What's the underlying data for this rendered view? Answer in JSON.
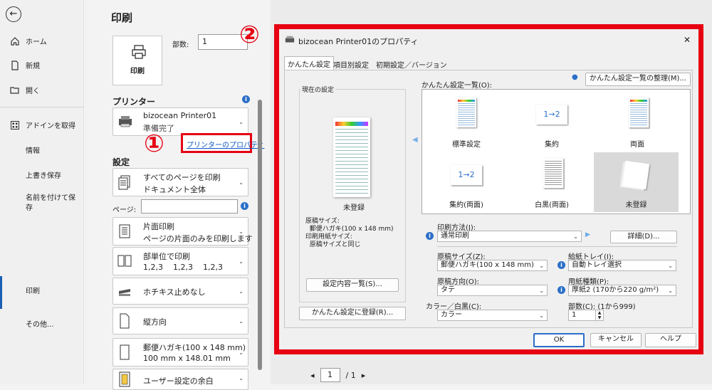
{
  "nav": {
    "items": [
      {
        "label": "ホーム",
        "icon": "home-icon"
      },
      {
        "label": "新規",
        "icon": "new-doc-icon"
      },
      {
        "label": "開く",
        "icon": "folder-icon"
      },
      {
        "label": "アドインを取得",
        "icon": "grid-icon"
      },
      {
        "label": "情報"
      },
      {
        "label": "上書き保存"
      },
      {
        "label": "名前を付けて保\n存"
      },
      {
        "label": "印刷"
      },
      {
        "label": "その他..."
      }
    ]
  },
  "print": {
    "title": "印刷",
    "print_button": "印刷",
    "copies_label": "部数:",
    "copies_value": "1",
    "printer_heading": "プリンター",
    "printer_name": "bizocean Printer01",
    "printer_status": "準備完了",
    "printer_props_link": "プリンターのプロパティ",
    "settings_heading": "設定",
    "options": [
      {
        "line1": "すべてのページを印刷",
        "line2": "ドキュメント全体"
      },
      {
        "line1": "片面印刷",
        "line2": "ページの片面のみを印刷します"
      },
      {
        "line1": "部単位で印刷",
        "line2": "1,2,3    1,2,3    1,2,3"
      },
      {
        "line1": "ホチキス止めなし",
        "line2": ""
      },
      {
        "line1": "縦方向",
        "line2": ""
      },
      {
        "line1": "郵便ハガキ(100 x 148 mm)",
        "line2": "100 mm x 148.01 mm"
      },
      {
        "line1": "ユーザー設定の余白",
        "line2": ""
      }
    ],
    "pages_label": "ページ:",
    "page_nav": {
      "current": "1",
      "total": "/ 1"
    }
  },
  "markers": {
    "one": "①",
    "two": "②"
  },
  "dialog": {
    "title": "bizocean Printer01のプロパティ",
    "tabs": [
      "かんたん設定",
      "項目別設定",
      "初期設定／バージョン"
    ],
    "current_settings": {
      "heading": "現在の設定",
      "unregistered": "未登録",
      "details": [
        "原稿サイズ:",
        "  郵便ハガキ(100 x 148 mm)",
        "印刷用紙サイズ:",
        "  原稿サイズと同じ"
      ],
      "list_button": "設定内容一覧(S)...",
      "register_button": "かんたん設定に登録(R)..."
    },
    "presets_label": "かんたん設定一覧(O):",
    "manage_button": "かんたん設定一覧の整理(M)...",
    "presets": [
      "標準設定",
      "集約",
      "両面",
      "集約(両面)",
      "白黒(両面)",
      "未登録"
    ],
    "presets_badge": "1→2",
    "fields": {
      "print_method_label": "印刷方法(J):",
      "print_method": "通常印刷",
      "detail_button": "詳細(D)...",
      "paper_size_label": "原稿サイズ(Z):",
      "paper_size": "郵便ハガキ(100 x 148 mm)",
      "tray_label": "給紙トレイ(I):",
      "tray": "自動トレイ選択",
      "orientation_label": "原稿方向(O):",
      "orientation": "タテ",
      "paper_type_label": "用紙種類(P):",
      "paper_type": "厚紙2 (170から220 g/m²)",
      "color_label": "カラー／白黒(C):",
      "color": "カラー",
      "copies_label": "部数(C): (1から999)",
      "copies": "1"
    },
    "ok": "OK",
    "cancel": "キャンセル",
    "help": "ヘルプ",
    "close": "✕"
  },
  "colors": {
    "highlight": "#e60012",
    "link": "#0b57c8",
    "nav_selected": "#1a5fb4"
  }
}
